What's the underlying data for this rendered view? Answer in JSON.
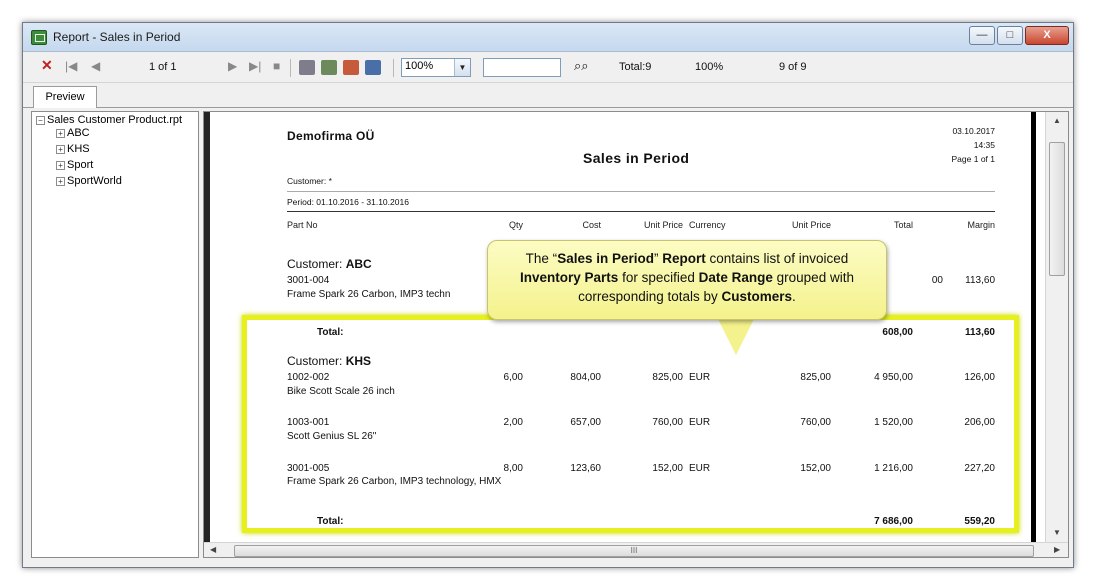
{
  "window": {
    "title": "Report - Sales in Period"
  },
  "titlebar_buttons": {
    "minimize": "—",
    "maximize": "□",
    "close": "X"
  },
  "toolbar": {
    "page_indicator": "1 of 1",
    "zoom": "100%",
    "search_value": "",
    "total_label": "Total:9",
    "percent_label": "100%",
    "of_label": "9 of 9"
  },
  "tabs": [
    {
      "label": "Preview"
    }
  ],
  "tree": {
    "root": "Sales Customer Product.rpt",
    "root_toggle": "−",
    "child_toggle": "+",
    "children": [
      "ABC",
      "KHS",
      "Sport",
      "SportWorld"
    ]
  },
  "report": {
    "company": "Demofirma OÜ",
    "title": "Sales in Period",
    "date": "03.10.2017",
    "time": "14:35",
    "page": "Page 1 of 1",
    "customer_filter": "Customer: *",
    "period": "Period: 01.10.2016 - 31.10.2016",
    "columns": [
      "Part No",
      "Qty",
      "Cost",
      "Unit Price",
      "Currency",
      "Unit Price",
      "Total",
      "Margin"
    ],
    "groups": [
      {
        "customer_prefix": "Customer:",
        "customer": "ABC",
        "rows": [
          {
            "part": "3001-004",
            "desc": "Frame Spark 26 Carbon, IMP3 techn",
            "total_partial": "00",
            "margin": "113,60"
          }
        ],
        "total_label": "Total:",
        "total": "608,00",
        "margin_total": "113,60"
      },
      {
        "customer_prefix": "Customer:",
        "customer": "KHS",
        "rows": [
          {
            "part": "1002-002",
            "desc": "Bike Scott Scale 26 inch",
            "qty": "6,00",
            "cost": "804,00",
            "unit_price": "825,00",
            "currency": "EUR",
            "unit_price2": "825,00",
            "total": "4 950,00",
            "margin": "126,00"
          },
          {
            "part": "1003-001",
            "desc": "Scott Genius SL 26\"",
            "qty": "2,00",
            "cost": "657,00",
            "unit_price": "760,00",
            "currency": "EUR",
            "unit_price2": "760,00",
            "total": "1 520,00",
            "margin": "206,00"
          },
          {
            "part": "3001-005",
            "desc": "Frame Spark 26 Carbon, IMP3 technology, HMX",
            "qty": "8,00",
            "cost": "123,60",
            "unit_price": "152,00",
            "currency": "EUR",
            "unit_price2": "152,00",
            "total": "1 216,00",
            "margin": "227,20"
          }
        ],
        "total_label": "Total:",
        "total": "7 686,00",
        "margin_total": "559,20"
      }
    ]
  },
  "callout": {
    "p1": "The “",
    "b1": "Sales in Period",
    "p2": "” ",
    "b2": "Report",
    "p3": " contains list of invoiced ",
    "b3": "Inventory Parts",
    "p4": " for specified ",
    "b4": "Date Range",
    "p5": " grouped with corresponding totals by ",
    "b5": "Customers",
    "p6": "."
  },
  "scrollbar": {
    "grip": "III"
  },
  "colors": {
    "highlight": "#e6f01e",
    "callout_bg": "#f4f28c",
    "stop_red": "#c02020"
  }
}
